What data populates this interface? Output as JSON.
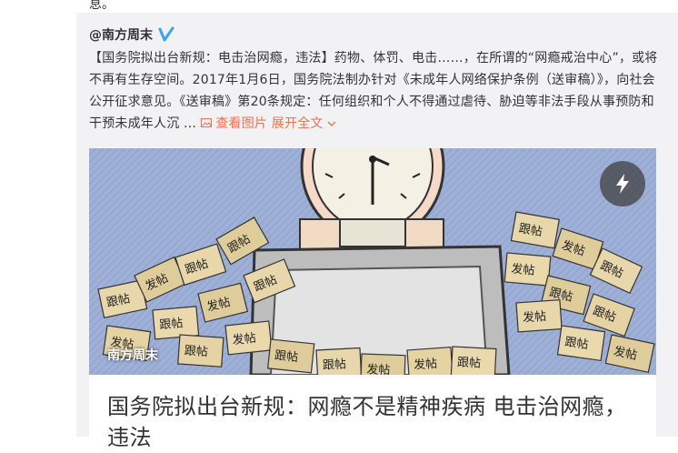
{
  "top": {
    "cut_text": "息。"
  },
  "post": {
    "author": "@南方周末",
    "verified_icon": "verified-v-icon",
    "text_main": "【国务院拟出台新规：电击治网瘾，违法】药物、体罚、电击……，在所谓的“网瘾戒治中心”，或将不再有生存空间。2017年1月6日，国务院法制办针对《未成年人网络保护条例（送审稿）》，向社会公开征求意见。《送审稿》第20条规定：任何组织和个人不得通过虐待、胁迫等非法手段从事预防和干预未成年人沉 ...",
    "view_pics": "查看图片",
    "expand": "展开全文"
  },
  "media": {
    "watermark": "南方周末",
    "action_icon": "lightning-icon",
    "sticky_notes": [
      "跟帖",
      "发帖",
      "跟帖",
      "发帖",
      "跟帖",
      "发帖",
      "跟帖",
      "跟帖",
      "发帖",
      "跟帖",
      "发帖",
      "跟帖",
      "跟帖",
      "发帖",
      "跟帖",
      "发帖",
      "跟帖",
      "跟帖",
      "发帖",
      "跟帖"
    ]
  },
  "card": {
    "title": "国务院拟出台新规：网瘾不是精神疾病 电击治网瘾，违法"
  },
  "colors": {
    "link": "#eb7350",
    "repost_bg": "#f2f2f5",
    "sky": "#9fb0d7"
  }
}
